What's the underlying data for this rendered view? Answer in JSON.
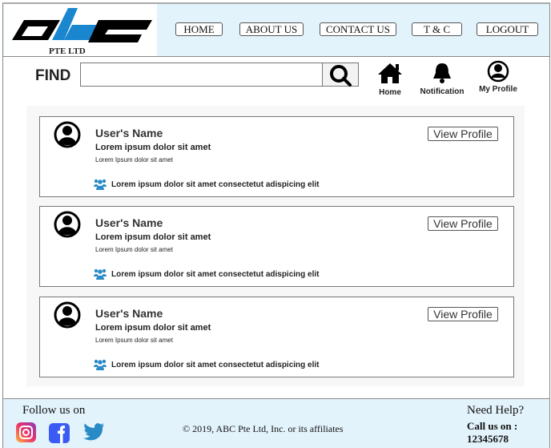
{
  "logo": {
    "text": "abc",
    "subtitle": "PTE LTD",
    "accent": "#1a86d0"
  },
  "nav": [
    "HOME",
    "ABOUT US",
    "CONTACT US",
    "T & C",
    "LOGOUT"
  ],
  "search": {
    "label": "FIND",
    "placeholder": ""
  },
  "toolbar": {
    "home": "Home",
    "notification": "Notification",
    "profile": "My Profile"
  },
  "cards": [
    {
      "name": "User's Name",
      "line1": "Lorem ipsum dolor sit amet",
      "line2": "Lorem Ipsum dolor sit amet",
      "group": "Lorem ipsum dolor sit amet consectetut adispicing elit",
      "button": "View Profile"
    },
    {
      "name": "User's Name",
      "line1": "Lorem ipsum dolor sit amet",
      "line2": "Lorem Ipsum dolor sit amet",
      "group": "Lorem ipsum dolor sit amet consectetut adispicing elit",
      "button": "View Profile"
    },
    {
      "name": "User's Name",
      "line1": "Lorem ipsum dolor sit amet",
      "line2": "Lorem Ipsum dolor sit amet",
      "group": "Lorem ipsum dolor sit amet consectetut adispicing elit",
      "button": "View Profile"
    }
  ],
  "footer": {
    "follow": "Follow us on",
    "copyright": "© 2019, ABC Pte Ltd, Inc. or its affiliates",
    "help": "Need Help?",
    "call": "Call us on :",
    "phone": "12345678"
  }
}
